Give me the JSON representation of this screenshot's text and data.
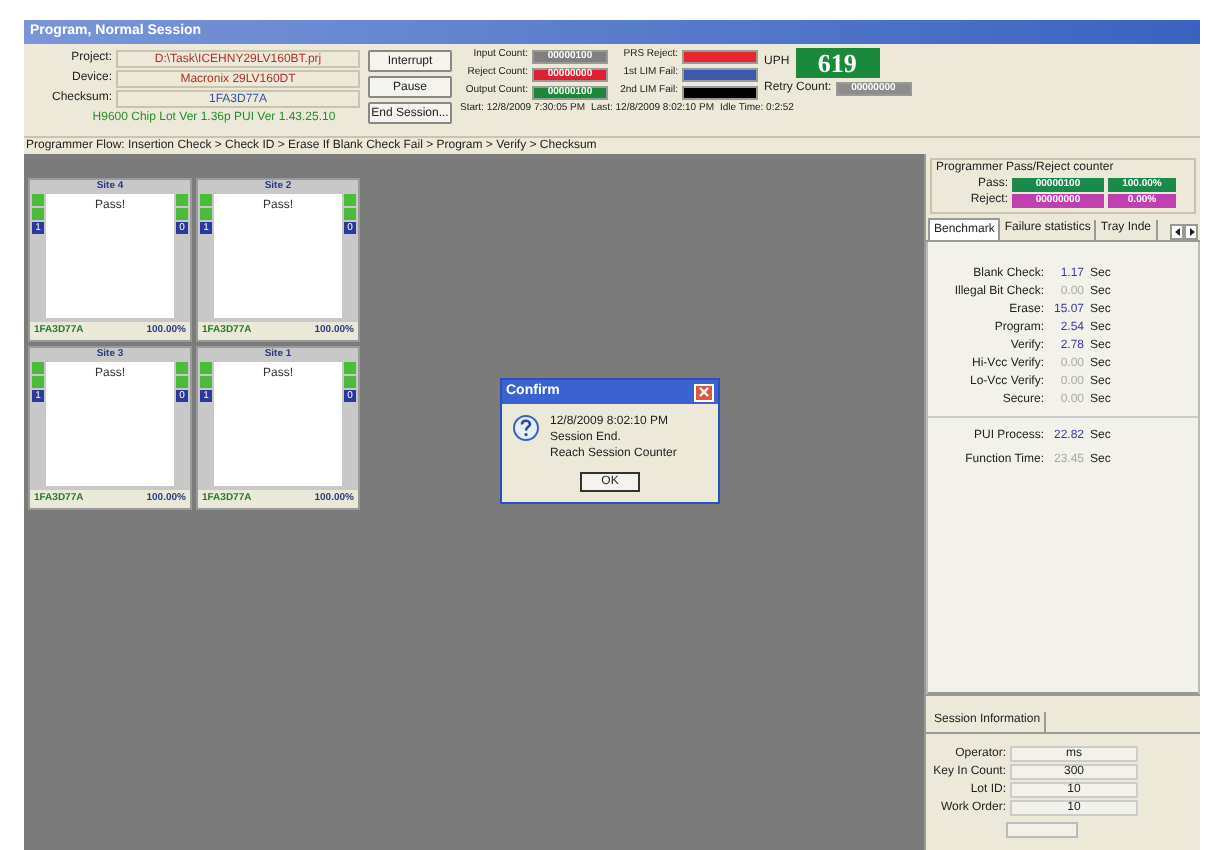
{
  "window": {
    "title": "Program, Normal Session"
  },
  "info": [
    {
      "label": "Project:",
      "value": "D:\\Task\\ICEHNY29LV160BT.prj",
      "color": "#b0302a"
    },
    {
      "label": "Device:",
      "value": "Macronix 29LV160DT",
      "color": "#b0302a"
    },
    {
      "label": "Checksum:",
      "value": "1FA3D77A",
      "color": "#3a4fa8"
    }
  ],
  "version": "H9600 Chip Lot Ver 1.36p  PUI Ver 1.43.25.10",
  "buttons": [
    "Interrupt",
    "Pause",
    "End Session..."
  ],
  "counts": [
    {
      "label": "Input Count:",
      "value": "00000100",
      "color": "#808080"
    },
    {
      "label": "Reject Count:",
      "value": "00000000",
      "color": "#e02030"
    },
    {
      "label": "Output Count:",
      "value": "00000100",
      "color": "#1a8a3a"
    }
  ],
  "fails": [
    {
      "label": "PRS Reject:",
      "color": "#e8262e"
    },
    {
      "label": "1st LIM Fail:",
      "color": "#3a5ab0"
    },
    {
      "label": "2nd LIM Fail:",
      "color": "#000000"
    }
  ],
  "uph": {
    "label": "UPH",
    "value": "619"
  },
  "retry": {
    "label": "Retry Count:",
    "value": "00000000"
  },
  "times": [
    "Start: 12/8/2009 7:30:05 PM",
    "Last: 12/8/2009 8:02:10 PM",
    "Idle Time: 0:2:52"
  ],
  "flow": "Programmer Flow: Insertion Check > Check ID > Erase If Blank Check Fail > Program > Verify > Checksum",
  "sites": [
    {
      "title": "Site 4",
      "status": "Pass!",
      "checksum": "1FA3D77A",
      "percent": "100.00%",
      "left_index": "1",
      "right_index": "0"
    },
    {
      "title": "Site 2",
      "status": "Pass!",
      "checksum": "1FA3D77A",
      "percent": "100.00%",
      "left_index": "1",
      "right_index": "0"
    },
    {
      "title": "Site 3",
      "status": "Pass!",
      "checksum": "1FA3D77A",
      "percent": "100.00%",
      "left_index": "1",
      "right_index": "0"
    },
    {
      "title": "Site 1",
      "status": "Pass!",
      "checksum": "1FA3D77A",
      "percent": "100.00%",
      "left_index": "1",
      "right_index": "0"
    }
  ],
  "dialog": {
    "title": "Confirm",
    "lines": [
      "12/8/2009 8:02:10 PM",
      "Session End.",
      "Reach Session Counter"
    ],
    "button": "OK"
  },
  "counter": {
    "title": "Programmer Pass/Reject counter",
    "rows": [
      {
        "label": "Pass:",
        "count": "00000100",
        "percent": "100.00%",
        "color": "#1a8a4a"
      },
      {
        "label": "Reject:",
        "count": "00000000",
        "percent": "0.00%",
        "color": "#c040b0"
      }
    ]
  },
  "tabs": [
    {
      "label": "Benchmark",
      "selected": true
    },
    {
      "label": "Failure statistics",
      "selected": false
    },
    {
      "label": "Tray Inde",
      "selected": false
    }
  ],
  "benchmark": [
    {
      "label": "Blank Check:",
      "value": "1.17",
      "unit": "Sec",
      "disabled": false
    },
    {
      "label": "Illegal Bit Check:",
      "value": "0.00",
      "unit": "Sec",
      "disabled": true
    },
    {
      "label": "Erase:",
      "value": "15.07",
      "unit": "Sec",
      "disabled": false
    },
    {
      "label": "Program:",
      "value": "2.54",
      "unit": "Sec",
      "disabled": false
    },
    {
      "label": "Verify:",
      "value": "2.78",
      "unit": "Sec",
      "disabled": false
    },
    {
      "label": "Hi-Vcc Verify:",
      "value": "0.00",
      "unit": "Sec",
      "disabled": true
    },
    {
      "label": "Lo-Vcc Verify:",
      "value": "0.00",
      "unit": "Sec",
      "disabled": true
    },
    {
      "label": "Secure:",
      "value": "0.00",
      "unit": "Sec",
      "disabled": true
    }
  ],
  "totals": [
    {
      "label": "PUI Process:",
      "value": "22.82",
      "unit": "Sec",
      "disabled": false
    },
    {
      "label": "Function Time:",
      "value": "23.45",
      "unit": "Sec",
      "disabled": true
    }
  ],
  "session": {
    "tab": "Session Information",
    "fields": [
      {
        "label": "Operator:",
        "value": "ms"
      },
      {
        "label": "Key In Count:",
        "value": "300"
      },
      {
        "label": "Lot ID:",
        "value": "10"
      },
      {
        "label": "Work Order:",
        "value": "10"
      }
    ]
  }
}
